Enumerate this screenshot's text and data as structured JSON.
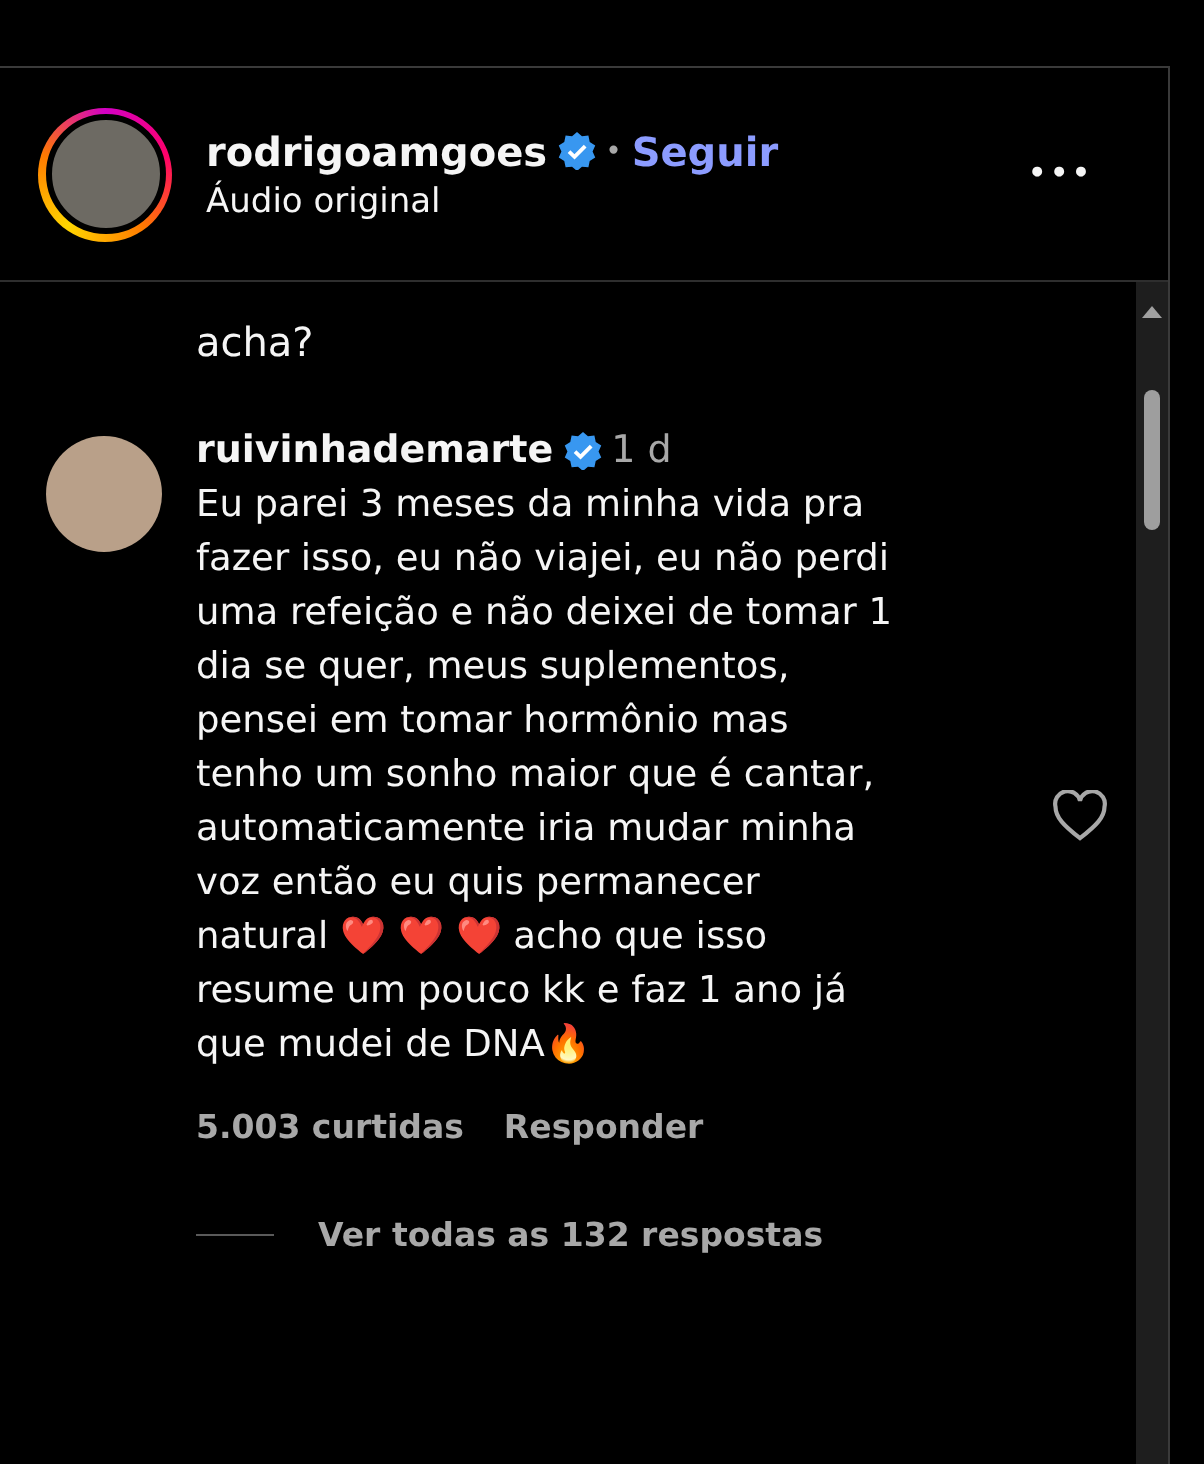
{
  "header": {
    "username": "rodrigoamgoes",
    "verified": true,
    "separator": "•",
    "follow_label": "Seguir",
    "subtitle": "Áudio original",
    "more_label": "•••"
  },
  "previous_comment_tail": "acha?",
  "comment": {
    "username": "ruivinhademarte",
    "verified": true,
    "time": "1 d",
    "text_lines": [
      "Eu parei 3 meses da minha vida pra",
      "fazer isso, eu não viajei, eu não perdi",
      "uma refeição e não deixei de tomar 1",
      "dia se quer, meus suplementos,",
      "pensei em tomar hormônio mas",
      "tenho um sonho maior que é cantar,",
      "automaticamente iria mudar minha",
      "voz então eu quis permanecer",
      "natural ❤️ ❤️ ❤️  acho que isso",
      "resume um pouco kk e faz 1 ano já",
      "que mudei de DNA🔥"
    ],
    "liked": false,
    "likes": "5.003 curtidas",
    "reply_label": "Responder",
    "view_replies": "Ver todas as 132 respostas"
  }
}
